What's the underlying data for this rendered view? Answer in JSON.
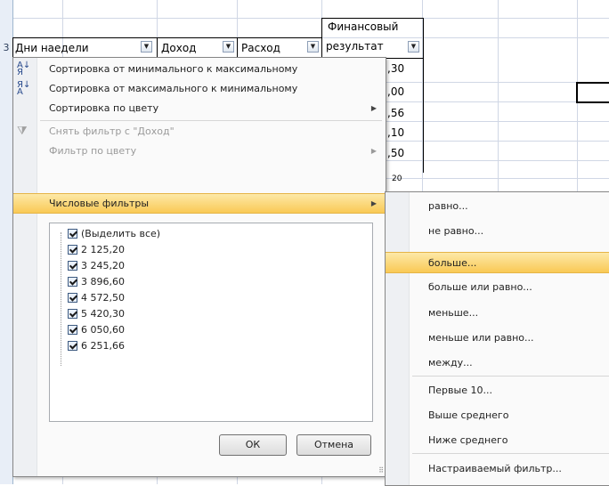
{
  "sheet": {
    "row_number": "3",
    "headers": [
      {
        "label": "Дни наедели"
      },
      {
        "label": "Доход"
      },
      {
        "label": "Расход"
      },
      {
        "label_line1": "Финансовый",
        "label_line2": "результат"
      }
    ],
    "partial_values": [
      ",30",
      ",00",
      ",56",
      ",10",
      ",50",
      "20"
    ]
  },
  "menu": {
    "sort_asc": "Сортировка от минимального к максимальному",
    "sort_desc": "Сортировка от максимального к минимальному",
    "sort_color": "Сортировка по цвету",
    "clear_filter": "Снять фильтр с \"Доход\"",
    "filter_color": "Фильтр по цвету",
    "number_filters": "Числовые фильтры",
    "select_all": "(Выделить все)",
    "values": [
      "2 125,20",
      "3 245,20",
      "3 896,60",
      "4 572,50",
      "5 420,30",
      "6 050,60",
      "6 251,66"
    ],
    "ok": "ОК",
    "cancel": "Отмена"
  },
  "submenu": {
    "items": [
      "равно...",
      "не равно...",
      "больше...",
      "больше или равно...",
      "меньше...",
      "меньше или равно...",
      "между...",
      "Первые 10...",
      "Выше среднего",
      "Ниже среднего",
      "Настраиваемый фильтр..."
    ],
    "highlighted": "больше..."
  },
  "colors": {
    "highlight": "#f9c955",
    "grid": "#d0d7e5"
  }
}
